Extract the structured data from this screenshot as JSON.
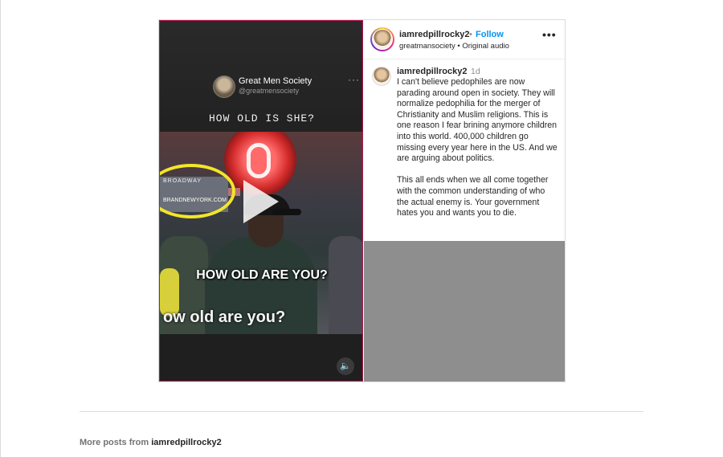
{
  "video": {
    "channel_name": "Great Men Society",
    "channel_handle": "@greatmensociety",
    "more_label": "···",
    "question_text": "HOW OLD IS SHE?",
    "sign_text_1": "BROADWAY",
    "sign_text_2": "BRANDNEWYORK.COM",
    "caption_top": "HOW OLD ARE YOU?",
    "caption_bottom": "ow old are you?",
    "mute_icon": "🔈"
  },
  "post": {
    "username": "iamredpillrocky2",
    "separator": "•",
    "follow_label": "Follow",
    "audio_source": "greatmansociety",
    "audio_label": "Original audio",
    "more_label": "•••",
    "caption": {
      "username": "iamredpillrocky2",
      "time": "1d",
      "paragraph_1": "I can't believe pedophiles are now parading around open in society. They will normalize pedophilia for the merger of Christianity and Muslim religions. This is one reason I fear brining anymore children into this world. 400,000 children go missing every year here in the US. And we are arguing about politics.",
      "paragraph_2": "This all ends when we all come together with the common understanding of who the actual enemy is. Your government hates you and wants you to die."
    }
  },
  "footer": {
    "more_posts_prefix": "More posts from",
    "more_posts_user": "iamredpillrocky2"
  },
  "colors": {
    "follow": "#0095f6",
    "highlight_circle": "#f3e52a",
    "video_border": "#b3164f"
  }
}
